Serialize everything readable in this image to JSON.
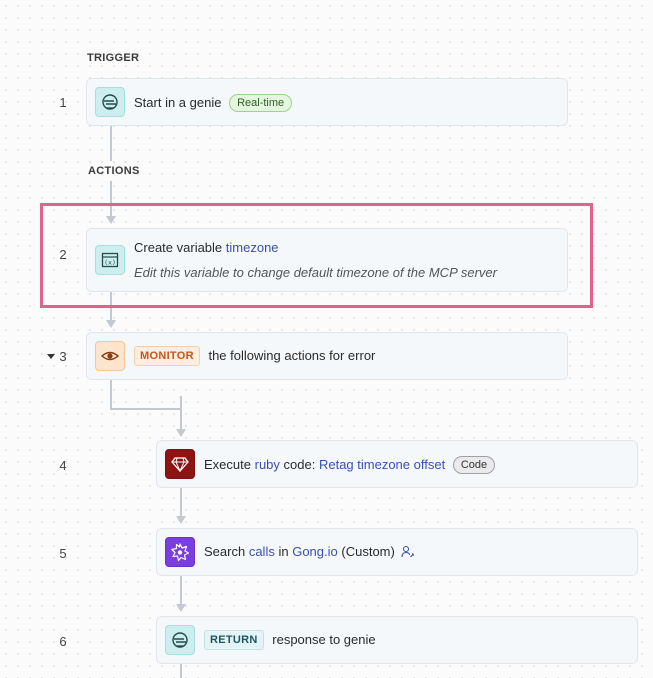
{
  "sections": {
    "trigger": "TRIGGER",
    "actions": "ACTIONS"
  },
  "steps": [
    {
      "num": "1",
      "text": "Start in a genie",
      "badge": "Real-time",
      "icon": "genie-icon"
    },
    {
      "num": "2",
      "prefix": "Create variable",
      "variable": "timezone",
      "description": "Edit this variable to change default timezone of the MCP server",
      "icon": "variable-icon"
    },
    {
      "num": "3",
      "tag": "MONITOR",
      "text": "the following actions for error",
      "icon": "eye-icon"
    },
    {
      "num": "4",
      "prefix": "Execute",
      "language": "ruby",
      "middle": "code:",
      "name": "Retag timezone offset",
      "badge": "Code",
      "icon": "ruby-icon"
    },
    {
      "num": "5",
      "prefix": "Search",
      "object": "calls",
      "middle": "in",
      "app": "Gong.io",
      "suffix": "(Custom)",
      "icon": "gong-icon"
    },
    {
      "num": "6",
      "tag": "RETURN",
      "text": "response to genie",
      "icon": "genie-icon"
    }
  ],
  "colors": {
    "highlight": "#e3628c",
    "link": "#3b4fae",
    "monitor_tag": "#c4561a",
    "ruby": "#8e1414",
    "gong": "#7a3de0"
  }
}
